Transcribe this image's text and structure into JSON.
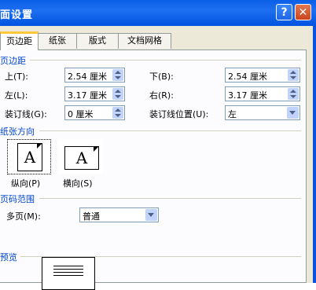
{
  "window": {
    "title": "面设置",
    "help": "?",
    "close": "✕"
  },
  "tabs": [
    "页边距",
    "纸张",
    "版式",
    "文档网格"
  ],
  "margins": {
    "heading": "页边距",
    "top_label": "上(T):",
    "top_value": "2.54 厘米",
    "bottom_label": "下(B):",
    "bottom_value": "2.54 厘米",
    "left_label": "左(L):",
    "left_value": "3.17 厘米",
    "right_label": "右(R):",
    "right_value": "3.17 厘米",
    "gutter_label": "装订线(G):",
    "gutter_value": "0 厘米",
    "gutter_pos_label": "装订线位置(U):",
    "gutter_pos_value": "左"
  },
  "orientation": {
    "heading": "纸张方向",
    "portrait_label": "纵向(P)",
    "landscape_label": "横向(S)",
    "icon_letter": "A"
  },
  "pages": {
    "heading": "页码范围",
    "multi_label": "多页(M):",
    "multi_value": "普通"
  },
  "preview": {
    "heading": "预览"
  }
}
